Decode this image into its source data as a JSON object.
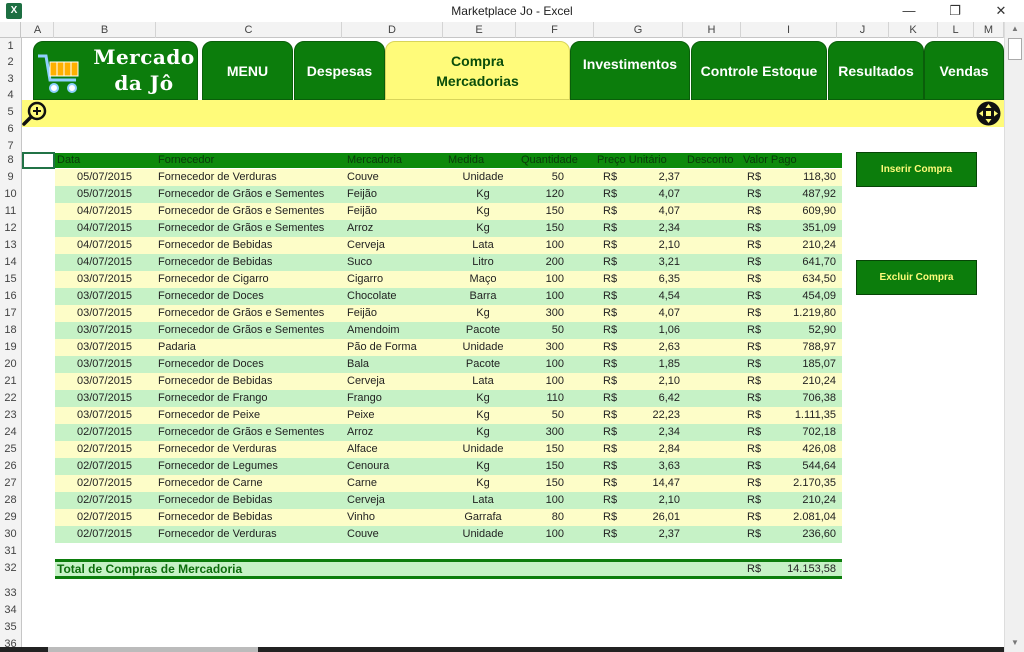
{
  "window": {
    "title": "Marketplace Jo - Excel",
    "app_icon": "X",
    "controls": [
      "—",
      "❐",
      "✕"
    ]
  },
  "columns": [
    "A",
    "B",
    "C",
    "D",
    "E",
    "F",
    "G",
    "H",
    "I",
    "J",
    "K",
    "L",
    "M"
  ],
  "rows": [
    "1",
    "2",
    "3",
    "4",
    "5",
    "6",
    "7",
    "8",
    "9",
    "10",
    "11",
    "12",
    "13",
    "14",
    "15",
    "16",
    "17",
    "18",
    "19",
    "20",
    "21",
    "22",
    "23",
    "24",
    "25",
    "26",
    "27",
    "28",
    "29",
    "30",
    "31",
    "32",
    "33",
    "34",
    "35",
    "36"
  ],
  "logo": {
    "line1": "Mercado",
    "line2": "da Jô"
  },
  "nav": {
    "tabs": [
      {
        "label": "MENU"
      },
      {
        "label": "Despesas"
      },
      {
        "label_line1": "Compra",
        "label_line2": "Mercadorias"
      },
      {
        "label": "Investimentos"
      },
      {
        "label": "Controle Estoque"
      },
      {
        "label": "Resultados"
      },
      {
        "label": "Vendas"
      }
    ]
  },
  "table": {
    "headers": [
      "Data",
      "Fornecedor",
      "Mercadoria",
      "Medida",
      "Quantidade",
      "Preço Unitário",
      "Desconto",
      "Valor Pago"
    ],
    "currency": "R$",
    "rows": [
      [
        "05/07/2015",
        "Fornecedor de Verduras",
        "Couve",
        "Unidade",
        "50",
        "2,37",
        "118,30"
      ],
      [
        "05/07/2015",
        "Fornecedor de Grãos e Sementes",
        "Feijão",
        "Kg",
        "120",
        "4,07",
        "487,92"
      ],
      [
        "04/07/2015",
        "Fornecedor de Grãos e Sementes",
        "Feijão",
        "Kg",
        "150",
        "4,07",
        "609,90"
      ],
      [
        "04/07/2015",
        "Fornecedor de Grãos e Sementes",
        "Arroz",
        "Kg",
        "150",
        "2,34",
        "351,09"
      ],
      [
        "04/07/2015",
        "Fornecedor de Bebidas",
        "Cerveja",
        "Lata",
        "100",
        "2,10",
        "210,24"
      ],
      [
        "04/07/2015",
        "Fornecedor de Bebidas",
        "Suco",
        "Litro",
        "200",
        "3,21",
        "641,70"
      ],
      [
        "03/07/2015",
        "Fornecedor de Cigarro",
        "Cigarro",
        "Maço",
        "100",
        "6,35",
        "634,50"
      ],
      [
        "03/07/2015",
        "Fornecedor de Doces",
        "Chocolate",
        "Barra",
        "100",
        "4,54",
        "454,09"
      ],
      [
        "03/07/2015",
        "Fornecedor de Grãos e Sementes",
        "Feijão",
        "Kg",
        "300",
        "4,07",
        "1.219,80"
      ],
      [
        "03/07/2015",
        "Fornecedor de Grãos e Sementes",
        "Amendoim",
        "Pacote",
        "50",
        "1,06",
        "52,90"
      ],
      [
        "03/07/2015",
        "Padaria",
        "Pão de Forma",
        "Unidade",
        "300",
        "2,63",
        "788,97"
      ],
      [
        "03/07/2015",
        "Fornecedor de Doces",
        "Bala",
        "Pacote",
        "100",
        "1,85",
        "185,07"
      ],
      [
        "03/07/2015",
        "Fornecedor de Bebidas",
        "Cerveja",
        "Lata",
        "100",
        "2,10",
        "210,24"
      ],
      [
        "03/07/2015",
        "Fornecedor de Frango",
        "Frango",
        "Kg",
        "110",
        "6,42",
        "706,38"
      ],
      [
        "03/07/2015",
        "Fornecedor de Peixe",
        "Peixe",
        "Kg",
        "50",
        "22,23",
        "1.111,35"
      ],
      [
        "02/07/2015",
        "Fornecedor de Grãos e Sementes",
        "Arroz",
        "Kg",
        "300",
        "2,34",
        "702,18"
      ],
      [
        "02/07/2015",
        "Fornecedor de Verduras",
        "Alface",
        "Unidade",
        "150",
        "2,84",
        "426,08"
      ],
      [
        "02/07/2015",
        "Fornecedor de Legumes",
        "Cenoura",
        "Kg",
        "150",
        "3,63",
        "544,64"
      ],
      [
        "02/07/2015",
        "Fornecedor de Carne",
        "Carne",
        "Kg",
        "150",
        "14,47",
        "2.170,35"
      ],
      [
        "02/07/2015",
        "Fornecedor de Bebidas",
        "Cerveja",
        "Lata",
        "100",
        "2,10",
        "210,24"
      ],
      [
        "02/07/2015",
        "Fornecedor de Bebidas",
        "Vinho",
        "Garrafa",
        "80",
        "26,01",
        "2.081,04"
      ],
      [
        "02/07/2015",
        "Fornecedor de Verduras",
        "Couve",
        "Unidade",
        "100",
        "2,37",
        "236,60"
      ]
    ]
  },
  "total": {
    "label": "Total de Compras de Mercadoria",
    "currency": "R$",
    "value": "14.153,58"
  },
  "buttons": {
    "insert": "Inserir Compra",
    "delete": "Excluir Compra"
  },
  "colors": {
    "green": "#0c7d0c",
    "yellow": "#fffb7a",
    "rowA": "#fdfdc8",
    "rowB": "#c6f2c6"
  }
}
